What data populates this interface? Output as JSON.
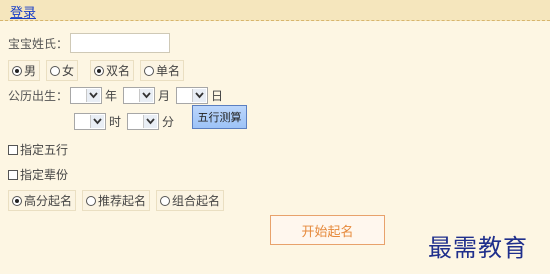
{
  "header": {
    "login": "登录"
  },
  "form": {
    "surname_label": "宝宝姓氏：",
    "surname_value": "",
    "gender": {
      "male": "男",
      "female": "女"
    },
    "name_type": {
      "double": "双名",
      "single": "单名"
    },
    "birth_label": "公历出生：",
    "year": "年",
    "month": "月",
    "day": "日",
    "hour": "时",
    "minute": "分",
    "wuxing_button": "五行测算",
    "specify_wuxing": "指定五行",
    "specify_generation": "指定辈份",
    "method": {
      "high": "高分起名",
      "recommend": "推荐起名",
      "combo": "组合起名"
    },
    "start_button": "开始起名"
  },
  "watermark": "最需教育"
}
